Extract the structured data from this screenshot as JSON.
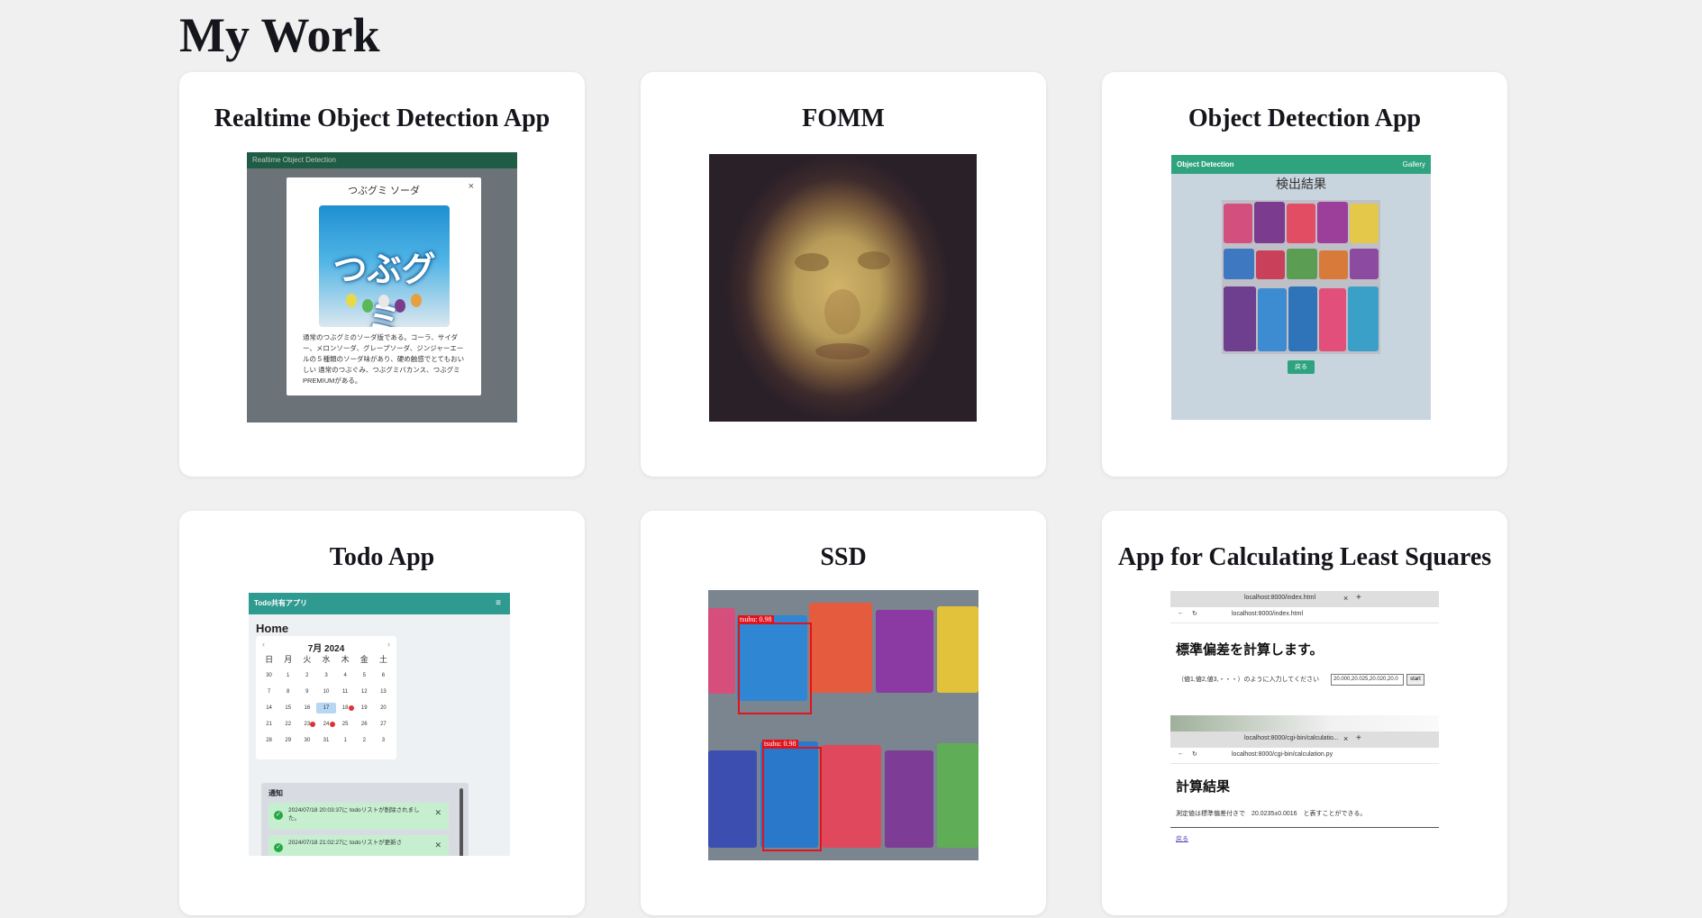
{
  "page": {
    "title": "My Work"
  },
  "cards": [
    {
      "title": "Realtime Object Detection App",
      "shot": {
        "app_bar": "Realtime Object Detection",
        "modal_title": "つぶグミ ソーダ",
        "close": "×",
        "candy_label": "つぶグミ",
        "description": "通常のつぶグミのソーダ版である。コーラ、サイダー、メロンソーダ、グレープソーダ、ジンジャーエールの５種類のソーダ味があり、硬め触感でとてもおいしい 通常のつぶぐみ、つぶグミバカンス、つぶグミPREMIUMがある。"
      }
    },
    {
      "title": "FOMM"
    },
    {
      "title": "Object Detection App",
      "shot": {
        "brand": "Object Detection",
        "nav": "Gallery",
        "heading": "検出結果",
        "button": "戻る"
      }
    },
    {
      "title": "Todo App",
      "shot": {
        "brand": "Todo共有アプリ",
        "menu": "≡",
        "home": "Home",
        "month": "7月 2024",
        "weekdays": [
          "日",
          "月",
          "火",
          "水",
          "木",
          "金",
          "土"
        ],
        "days": [
          "30",
          "1",
          "2",
          "3",
          "4",
          "5",
          "6",
          "7",
          "8",
          "9",
          "10",
          "11",
          "12",
          "13",
          "14",
          "15",
          "16",
          "17",
          "18",
          "19",
          "20",
          "21",
          "22",
          "23",
          "24",
          "25",
          "26",
          "27",
          "28",
          "29",
          "30",
          "31",
          "1",
          "2",
          "3"
        ],
        "notice_title": "通知",
        "notifications": [
          "2024/07/18 20:03:37に todoリストが削除されました。",
          "2024/07/18 21:02:27に todoリストが更新さ"
        ]
      }
    },
    {
      "title": "SSD",
      "shot": {
        "labels": [
          "tsubu: 0.98",
          "tsubu: 0.98"
        ]
      }
    },
    {
      "title": "App for Calculating Least Squares",
      "shot": {
        "tab1": "localhost:8000/index.html",
        "addr1": "localhost:8000/index.html",
        "heading1": "標準偏差を計算します。",
        "prompt": "（値1,値2,値3,・・・）のように入力してください",
        "input_value": "20.000,20.025,20.020,20.0",
        "start": "start",
        "tab2": "localhost:8000/cgi-bin/calculatio...",
        "addr2": "localhost:8000/cgi-bin/calculation.py",
        "heading2": "計算結果",
        "result": "測定値は標準偏差付きで　20.0235±0.0016　と表すことができる。",
        "back": "戻る"
      }
    }
  ]
}
